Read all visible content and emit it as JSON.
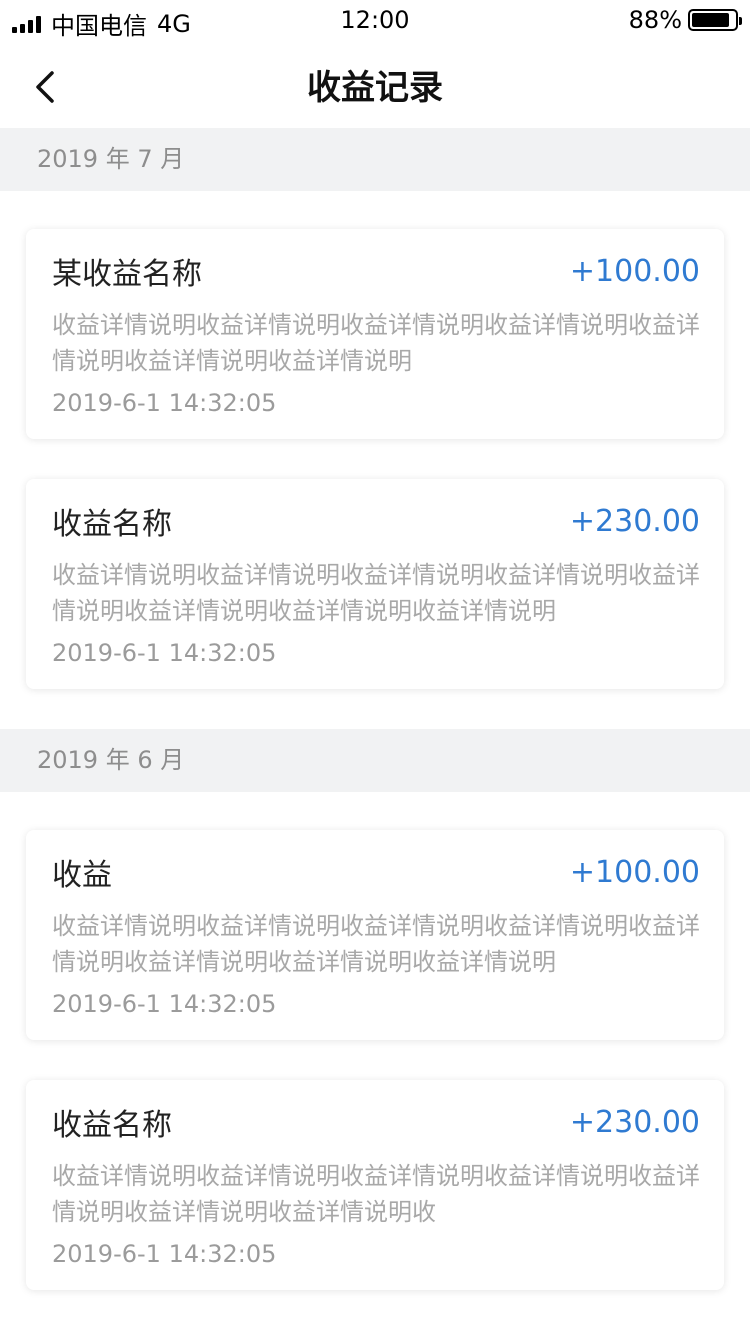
{
  "status_bar": {
    "carrier": "中国电信",
    "network": "4G",
    "time": "12:00",
    "battery_percent_text": "88%",
    "battery_level": 0.88
  },
  "nav": {
    "title": "收益记录",
    "back_icon": "chevron-left-icon"
  },
  "sections": [
    {
      "month": "2019 年 7 月",
      "items": [
        {
          "title": "某收益名称",
          "amount": "+100.00",
          "desc": "收益详情说明收益详情说明收益详情说明收益详情说明收益详情说明收益详情说明收益详情说明",
          "time": "2019-6-1 14:32:05"
        },
        {
          "title": "收益名称",
          "amount": "+230.00",
          "desc": "收益详情说明收益详情说明收益详情说明收益详情说明收益详情说明收益详情说明收益详情说明收益详情说明",
          "time": "2019-6-1 14:32:05"
        }
      ]
    },
    {
      "month": "2019 年 6 月",
      "items": [
        {
          "title": "收益",
          "amount": "+100.00",
          "desc": "收益详情说明收益详情说明收益详情说明收益详情说明收益详情说明收益详情说明收益详情说明收益详情说明",
          "time": "2019-6-1 14:32:05"
        },
        {
          "title": "收益名称",
          "amount": "+230.00",
          "desc": "收益详情说明收益详情说明收益详情说明收益详情说明收益详情说明收益详情说明收益详情说明收",
          "time": "2019-6-1 14:32:05"
        }
      ]
    }
  ],
  "colors": {
    "amount": "#2f7ad1",
    "section_bg": "#f1f2f3"
  }
}
